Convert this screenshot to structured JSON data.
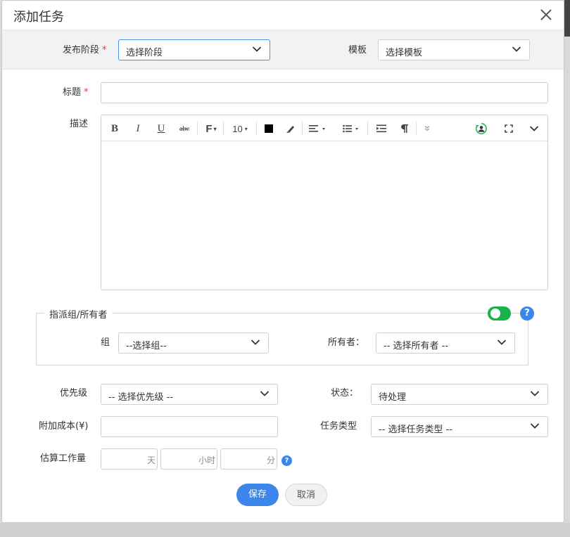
{
  "dialog": {
    "title": "添加任务"
  },
  "stage": {
    "label": "发布阶段",
    "required_mark": "*",
    "value": "选择阶段"
  },
  "template": {
    "label": "模板",
    "value": "选择模板"
  },
  "title_field": {
    "label": "标题",
    "required_mark": "*",
    "value": ""
  },
  "description": {
    "label": "描述",
    "toolbar": {
      "bold": "B",
      "italic": "I",
      "underline": "U",
      "strikethrough": "abc",
      "font_family": "F",
      "font_size": "10",
      "text_color": "#000000"
    },
    "content": ""
  },
  "assign": {
    "section_title": "指派组/所有者",
    "toggle_on": true,
    "toggle_color": "#18b248",
    "help": "?",
    "group_label": "组",
    "group_value": "--选择组--",
    "owner_label": "所有者：",
    "owner_value": "-- 选择所有者 --"
  },
  "priority": {
    "label": "优先级",
    "value": "-- 选择优先级 --"
  },
  "status": {
    "label": "状态：",
    "value": "待处理"
  },
  "extra_cost": {
    "label": "附加成本(¥)",
    "value": ""
  },
  "task_type": {
    "label": "任务类型",
    "value": "-- 选择任务类型 --"
  },
  "estimate": {
    "label": "估算工作量",
    "day_unit": "天",
    "hour_unit": "小时",
    "minute_unit": "分",
    "help": "?"
  },
  "actions": {
    "save": "保存",
    "cancel": "取消",
    "accent_color": "#3b86e8"
  },
  "icons": [
    "close-icon",
    "chevron-down-icon",
    "bold-icon",
    "italic-icon",
    "underline-icon",
    "strikethrough-icon",
    "font-family-icon",
    "font-size-icon",
    "text-color-icon",
    "highlight-icon",
    "align-icon",
    "bullet-list-icon",
    "indent-icon",
    "paragraph-icon",
    "more-icon",
    "user-sync-icon",
    "fullscreen-icon",
    "collapse-icon",
    "help-icon"
  ]
}
